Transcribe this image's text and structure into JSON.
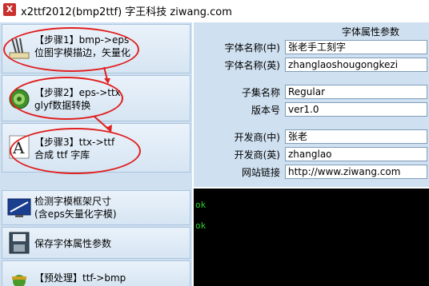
{
  "window": {
    "title": "x2ttf2012(bmp2ttf) 字王科技 ziwang.com",
    "icon": "app-icon"
  },
  "steps": [
    {
      "icon": "pen-icon",
      "line1": "【步骤1】bmp->eps",
      "line2": "位图字模描边，矢量化"
    },
    {
      "icon": "gear-icon",
      "line1": "【步骤2】eps->ttx",
      "line2": "glyf数据转换"
    },
    {
      "icon": "font-a-icon",
      "line1": "【步骤3】ttx->ttf",
      "line2": "合成 ttf 字库"
    },
    {
      "icon": "monitor-icon",
      "line1": "检测字模框架尺寸",
      "line2": "(含eps矢量化字模)"
    },
    {
      "icon": "save-icon",
      "line1": "保存字体属性参数",
      "line2": ""
    },
    {
      "icon": "preprocess-icon",
      "line1": "【预处理】ttf->bmp",
      "line2": ""
    }
  ],
  "properties": {
    "section_title": "字体属性参数",
    "fields": [
      {
        "label": "字体名称(中)",
        "value": "张老手工刻字"
      },
      {
        "label": "字体名称(英)",
        "value": "zhanglaoshougongkezi"
      },
      {
        "label": "子集名称",
        "value": "Regular"
      },
      {
        "label": "版本号",
        "value": "ver1.0"
      },
      {
        "label": "开发商(中)",
        "value": "张老"
      },
      {
        "label": "开发商(英)",
        "value": "zhanglao"
      },
      {
        "label": "网站链接",
        "value": "http://www.ziwang.com"
      }
    ]
  },
  "console": {
    "lines": [
      "ok",
      "ok"
    ]
  },
  "colors": {
    "annotation": "#e02020",
    "console_bg": "#000000",
    "console_text": "#2ad12a",
    "panel_bg": "#cfe0f0"
  }
}
